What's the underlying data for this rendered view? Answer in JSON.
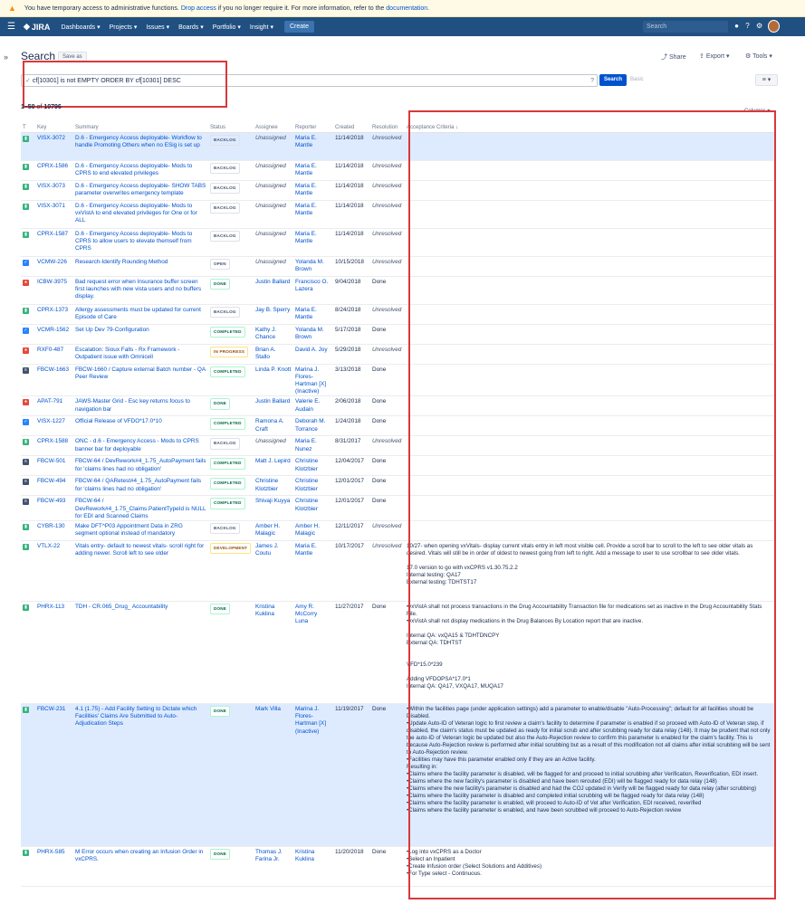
{
  "banner": {
    "text": "You have temporary access to administrative functions.",
    "link_drop": "Drop access",
    "text2": "if you no longer require it. For more information, refer to the",
    "link_doc": "documentation."
  },
  "nav": {
    "logo": "JIRA",
    "items": [
      "Dashboards ▾",
      "Projects ▾",
      "Issues ▾",
      "Boards ▾",
      "Portfolio ▾",
      "Insight ▾"
    ],
    "create": "Create",
    "search_placeholder": "Search"
  },
  "page": {
    "title": "Search",
    "save_as": "Save as",
    "share": "Share",
    "export": "Export ▾",
    "tools": "Tools ▾",
    "count_prefix": "1–50",
    "count_of": "of",
    "count_total": "10796",
    "columns": "Columns ▾"
  },
  "jql": {
    "query": "cf[10301] is not EMPTY ORDER BY cf[10301] DESC",
    "search_btn": "Search",
    "basic": "Basic"
  },
  "columns": [
    "T",
    "Key",
    "Summary",
    "Status",
    "Assignee",
    "Reporter",
    "Created",
    "Resolution",
    "Acceptance Criteria ↓"
  ],
  "colors": {
    "story": "#36b37e",
    "task": "#2684ff",
    "bug": "#e5493a",
    "subtask": "#2684ff",
    "change": "#42526e",
    "nav": "#205081"
  },
  "rows": [
    {
      "type": "story",
      "key": "VISX-3072",
      "summary": "D.6 - Emergency Access deployable- Workflow to handle Promoting Others when no ESig is set up",
      "status": "BACKLOG",
      "assignee": "Unassigned",
      "reporter": "Maria E. Mantle",
      "created": "11/14/2018",
      "resolution": "Unresolved",
      "ac": "",
      "sel": true
    },
    {
      "type": "story",
      "key": "CPRX-1586",
      "summary": "D.6 - Emergency Access deployable- Mods to CPRS to end elevated privileges",
      "status": "BACKLOG",
      "assignee": "Unassigned",
      "reporter": "Maria E. Mantle",
      "created": "11/14/2018",
      "resolution": "Unresolved",
      "ac": ""
    },
    {
      "type": "story",
      "key": "VISX-3073",
      "summary": "D.6 - Emergency Access deployable- SHOW TABS parameter overwrites emergency template",
      "status": "BACKLOG",
      "assignee": "Unassigned",
      "reporter": "Maria E. Mantle",
      "created": "11/14/2018",
      "resolution": "Unresolved",
      "ac": ""
    },
    {
      "type": "story",
      "key": "VISX-3071",
      "summary": "D.6 - Emergency Access deployable- Mods to vxVistA to end elevated privileges for One or for ALL",
      "status": "BACKLOG",
      "assignee": "Unassigned",
      "reporter": "Maria E. Mantle",
      "created": "11/14/2018",
      "resolution": "Unresolved",
      "ac": ""
    },
    {
      "type": "story",
      "key": "CPRX-1587",
      "summary": "D.6 - Emergency Access deployable- Mods to CPRS to allow users to elevate themself from CPRS",
      "status": "BACKLOG",
      "assignee": "Unassigned",
      "reporter": "Maria E. Mantle",
      "created": "11/14/2018",
      "resolution": "Unresolved",
      "ac": ""
    },
    {
      "type": "task",
      "key": "VCMW-226",
      "summary": "Research-Identify Rounding Method",
      "status": "OPEN",
      "assignee": "Unassigned",
      "reporter": "Yolanda M. Brown",
      "created": "10/15/2018",
      "resolution": "Unresolved",
      "ac": ""
    },
    {
      "type": "bug",
      "key": "ICBW-3975",
      "summary": "Bad request error when Insurance buffer screen first launches with new vista users and no buffers display.",
      "status": "DONE",
      "assignee": "Justin Ballard",
      "reporter": "Francisco O. Lazera",
      "created": "9/04/2018",
      "resolution": "Done",
      "ac": ""
    },
    {
      "type": "story",
      "key": "CPRX-1373",
      "summary": "Allergy assessments must be updated for current Episode of Care",
      "status": "BACKLOG",
      "assignee": "Jay B. Sperry",
      "reporter": "Maria E. Mantle",
      "created": "8/24/2018",
      "resolution": "Unresolved",
      "ac": ""
    },
    {
      "type": "task",
      "key": "VCMR-1562",
      "summary": "Set Up Dev 79-Configuration",
      "status": "COMPLETED",
      "assignee": "Kathy J. Chance",
      "reporter": "Yolanda M. Brown",
      "created": "5/17/2018",
      "resolution": "Done",
      "ac": ""
    },
    {
      "type": "bug",
      "key": "RXF0-487",
      "summary": "Escalation: Sioux Falls - Rx Framework - Outpatient issue with Omnicell",
      "status": "IN PROGRESS",
      "assignee": "Brian A. Stallo",
      "reporter": "David A. Joy",
      "created": "5/29/2018",
      "resolution": "Unresolved",
      "ac": ""
    },
    {
      "type": "change",
      "key": "FBCW-1663",
      "summary": "FBCW-1660 / Capture external Batch number - QA Peer Review",
      "status": "COMPLETED",
      "assignee": "Linda P. Knott",
      "reporter": "Marina J. Flores-Hartman [X] (Inactive)",
      "created": "3/13/2018",
      "resolution": "Done",
      "ac": ""
    },
    {
      "type": "bug",
      "key": "APAT-791",
      "summary": "JAWS-Master Grid - Esc key returns focus to navigation bar",
      "status": "DONE",
      "assignee": "Justin Ballard",
      "reporter": "Valerie E. Audain",
      "created": "2/06/2018",
      "resolution": "Done",
      "ac": ""
    },
    {
      "type": "task",
      "key": "VISX-1227",
      "summary": "Official Release of VFDO*17.0*10",
      "status": "COMPLETED",
      "assignee": "Ramona A. Craft",
      "reporter": "Deborah M. Torrance",
      "created": "1/24/2018",
      "resolution": "Done",
      "ac": ""
    },
    {
      "type": "story",
      "key": "CPRX-1588",
      "summary": "ONC - d.6 - Emergency Access - Mods to CPRS banner bar for deployable",
      "status": "BACKLOG",
      "assignee": "Unassigned",
      "reporter": "Maria E. Nunez",
      "created": "8/31/2017",
      "resolution": "Unresolved",
      "ac": ""
    },
    {
      "type": "change",
      "key": "FBCW-501",
      "summary": "FBCW-64 / DevRework#4_1.75_AutoPayment fails for 'claims lines had no obligation'",
      "status": "COMPLETED",
      "assignee": "Matt J. Lepird",
      "reporter": "Christine Klotzbier",
      "created": "12/04/2017",
      "resolution": "Done",
      "ac": ""
    },
    {
      "type": "change",
      "key": "FBCW-494",
      "summary": "FBCW-64 / QARetest#4_1.75_AutoPayment fails for 'claims lines had no obligation'",
      "status": "COMPLETED",
      "assignee": "Christine Klotzbier",
      "reporter": "Christine Klotzbier",
      "created": "12/01/2017",
      "resolution": "Done",
      "ac": ""
    },
    {
      "type": "change",
      "key": "FBCW-493",
      "summary": "FBCW-64 / DevRework#4_1.75_Claims.PatientTypeId is NULL for EDI and Scanned Claims",
      "status": "COMPLETED",
      "assignee": "Shivaji Kuyya",
      "reporter": "Christine Klotzbier",
      "created": "12/01/2017",
      "resolution": "Done",
      "ac": ""
    },
    {
      "type": "story",
      "key": "CYBR-130",
      "summary": "Make DFT^P03 Appointment Data in ZRG segment optional instead of mandatory",
      "status": "BACKLOG",
      "assignee": "Amber H. Malagic",
      "reporter": "Amber H. Malagic",
      "created": "12/11/2017",
      "resolution": "Unresolved",
      "ac": ""
    },
    {
      "type": "story",
      "key": "VTLX-22",
      "summary": "Vitals entry- default to newest vitals- scroll right for adding newer. Scroll left to see older",
      "status": "DEVELOPMENT",
      "assignee": "James J. Coutu",
      "reporter": "Maria E. Mantle",
      "created": "10/17/2017",
      "resolution": "Unresolved",
      "ac": "10/27- when opening vxVitals- display current vitals entry in left most visible cell. Provide a scroll bar to scroll to the left to see older vitals as desired. Vitals will still be in order of oldest to newest going from left to right. Add a message to user to use scrollbar to see older vitals.\n\n17.0 version to go with vxCPRS v1.30.75.2.2\nInternal testing: QA17\nExternal testing: TDHTST17"
    },
    {
      "type": "story",
      "key": "PHRX-113",
      "summary": "TDH - CR.065_Drug_ Accountability",
      "status": "DONE",
      "assignee": "Kristina Kuklina",
      "reporter": "Amy R. McCorry Luna",
      "created": "11/27/2017",
      "resolution": "Done",
      "ac": "•vxVistA shall not process transactions in the Drug Accountability Transaction file for medications set as inactive in the Drug Accountability Stats File.\n•vxVistA shall not display medications in the Drug Balances By Location report that are inactive.\n\nInternal QA: vxQA15 & TDHTDNCPY\nExternal QA: TDHTST\n\n\nVFD*15.0*239\n\nAdding VFDOPSA*17.0*1\nInternal QA: QA17, VXQA17, MUQA17"
    },
    {
      "type": "story",
      "key": "FBCW-231",
      "summary": "4.1 (1.75) - Add Facility Setting to Dictate which Facilities' Claims Are Submitted to Auto-Adjudication Steps",
      "status": "DONE",
      "assignee": "Mark Villa",
      "reporter": "Marina J. Flores-Hartman [X] (Inactive)",
      "created": "11/19/2017",
      "resolution": "Done",
      "ac": "•Within the facilities page (under application settings) add a parameter to enable/disable \"Auto-Processing\"; default for all facilities should be Disabled.\n•Update Auto-ID of Veteran logic to first review a claim's facility to determine if parameter is enabled if so proceed with Auto-ID of Veteran step, if disabled, the claim's status must be updated as ready for initial scrub and after scrubbing ready for data relay (148). It may be prudent that not only the auto-ID of Veteran logic be updated but also the Auto-Rejection review to confirm this parameter is enabled for the claim's facility. This is because Auto-Rejection review is performed after initial scrubbing but as a result of this modification not all claims after initial scrubbing will be sent to Auto-Rejection review.\n•Facilities may have this parameter enabled only if they are an Active facility.\nResulting in:\n•Claims where the facility parameter is disabled, will be flagged for and proceed to initial scrubbing after Verification, Reverification, EDI insert.\n•Claims where the new facility's parameter is disabled and have been rerouted (EDI) will be flagged ready for data relay (148)\n•Claims where the new facility's parameter is disabled and had the COJ updated in Verify will be flagged ready for data relay (after scrubbing)\n•Claims where the facility parameter is disabled and completed initial scrubbing will be flagged ready for data relay (148)\n•Claims where the facility parameter is enabled, will proceed to Auto-ID of Vet after Verification, EDI received, reverified\n•Claims where the facility parameter is enabled, and have been scrubbed will proceed to Auto-Rejection review",
      "sel": true
    },
    {
      "type": "story",
      "key": "PHRX-585",
      "summary": "M Error occurs when creating an Infusion Order in vxCPRS.",
      "status": "DONE",
      "assignee": "Thomas J. Farina Jr.",
      "reporter": "Kristina Kuklina",
      "created": "11/20/2018",
      "resolution": "Done",
      "ac": "•Log into vxCPRS as a Doctor\n•Select an Inpatient\n•Create Infusion order (Select Solutions and Additives)\n•For Type select - Continuous."
    }
  ]
}
